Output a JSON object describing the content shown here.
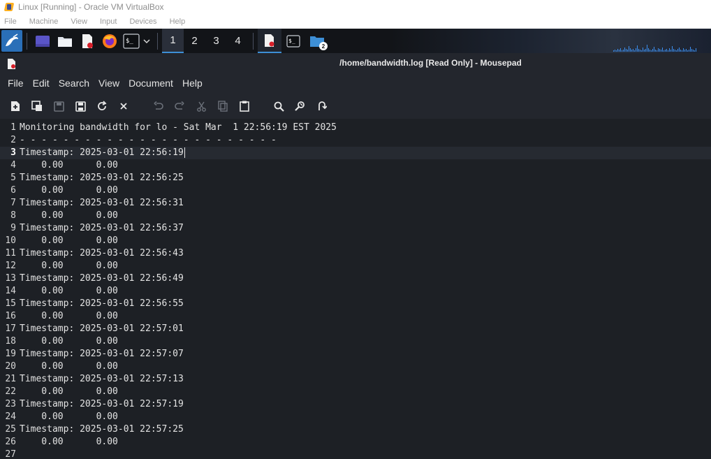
{
  "host": {
    "title": "Linux [Running] - Oracle VM VirtualBox",
    "menu": [
      "File",
      "Machine",
      "View",
      "Input",
      "Devices",
      "Help"
    ]
  },
  "panel": {
    "workspaces": [
      "1",
      "2",
      "3",
      "4"
    ],
    "active_workspace": "1",
    "folder_badge": "2",
    "launchers": [
      "kali-menu-icon",
      "desktop-icon",
      "file-manager-icon",
      "mousepad-icon",
      "firefox-icon",
      "terminal-icon"
    ]
  },
  "window": {
    "title": "/home/bandwidth.log [Read Only] - Mousepad",
    "menu": [
      "File",
      "Edit",
      "Search",
      "View",
      "Document",
      "Help"
    ]
  },
  "editor": {
    "current_line": 3,
    "lines": [
      {
        "n": "1",
        "text": "Monitoring bandwidth for lo - Sat Mar  1 22:56:19 EST 2025"
      },
      {
        "n": "2",
        "text": "- - - - - - - - - - - - - - - - - - - - - - - -"
      },
      {
        "n": "3",
        "text": "Timestamp: 2025-03-01 22:56:19"
      },
      {
        "n": "4",
        "text": "    0.00      0.00"
      },
      {
        "n": "5",
        "text": "Timestamp: 2025-03-01 22:56:25"
      },
      {
        "n": "6",
        "text": "    0.00      0.00"
      },
      {
        "n": "7",
        "text": "Timestamp: 2025-03-01 22:56:31"
      },
      {
        "n": "8",
        "text": "    0.00      0.00"
      },
      {
        "n": "9",
        "text": "Timestamp: 2025-03-01 22:56:37"
      },
      {
        "n": "10",
        "text": "    0.00      0.00"
      },
      {
        "n": "11",
        "text": "Timestamp: 2025-03-01 22:56:43"
      },
      {
        "n": "12",
        "text": "    0.00      0.00"
      },
      {
        "n": "13",
        "text": "Timestamp: 2025-03-01 22:56:49"
      },
      {
        "n": "14",
        "text": "    0.00      0.00"
      },
      {
        "n": "15",
        "text": "Timestamp: 2025-03-01 22:56:55"
      },
      {
        "n": "16",
        "text": "    0.00      0.00"
      },
      {
        "n": "17",
        "text": "Timestamp: 2025-03-01 22:57:01"
      },
      {
        "n": "18",
        "text": "    0.00      0.00"
      },
      {
        "n": "19",
        "text": "Timestamp: 2025-03-01 22:57:07"
      },
      {
        "n": "20",
        "text": "    0.00      0.00"
      },
      {
        "n": "21",
        "text": "Timestamp: 2025-03-01 22:57:13"
      },
      {
        "n": "22",
        "text": "    0.00      0.00"
      },
      {
        "n": "23",
        "text": "Timestamp: 2025-03-01 22:57:19"
      },
      {
        "n": "24",
        "text": "    0.00      0.00"
      },
      {
        "n": "25",
        "text": "Timestamp: 2025-03-01 22:57:25"
      },
      {
        "n": "26",
        "text": "    0.00      0.00"
      },
      {
        "n": "27",
        "text": ""
      }
    ]
  },
  "colors": {
    "editor_bg": "#1d2025",
    "chrome_bg": "#23262d",
    "accent": "#3d8fd6"
  }
}
